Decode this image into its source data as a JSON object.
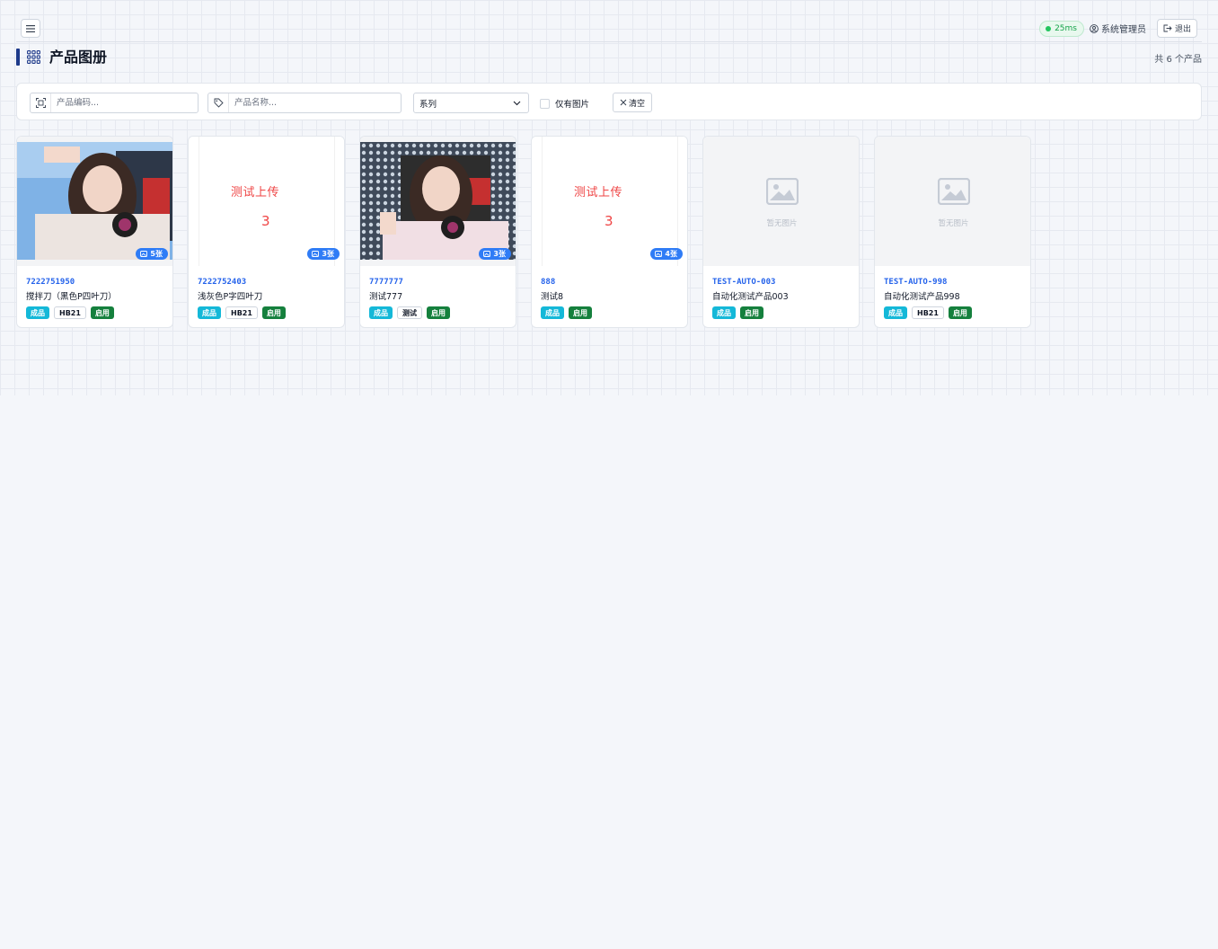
{
  "header": {
    "latency": "25ms",
    "user": "系统管理员",
    "logout_label": "退出"
  },
  "page": {
    "title": "产品图册",
    "count_text": "共 6 个产品"
  },
  "filters": {
    "code_placeholder": "产品编码...",
    "name_placeholder": "产品名称...",
    "series_label": "系列",
    "only_images_label": "仅有图片",
    "clear_label": "清空"
  },
  "colors": {
    "accent": "#2563eb",
    "badge": "#2f7cf6",
    "tag_type": "#14b8d8",
    "tag_status": "#15803d"
  },
  "products": [
    {
      "code": "7222751950",
      "name": "搅拌刀（黑色P四叶刀）",
      "image": "photo",
      "image_count": "5张",
      "type": "成品",
      "series": "HB21",
      "status": "启用"
    },
    {
      "code": "7222752403",
      "name": "浅灰色P字四叶刀",
      "image": "upload",
      "image_count": "3张",
      "upload_text": "测试上传",
      "upload_num": "3",
      "type": "成品",
      "series": "HB21",
      "status": "启用"
    },
    {
      "code": "7777777",
      "name": "测试777",
      "image": "photo",
      "image_count": "3张",
      "type": "成品",
      "series": "测试",
      "status": "启用"
    },
    {
      "code": "888",
      "name": "测试8",
      "image": "upload",
      "image_count": "4张",
      "upload_text": "测试上传",
      "upload_num": "3",
      "type": "成品",
      "series": "",
      "status": "启用"
    },
    {
      "code": "TEST-AUTO-003",
      "name": "自动化测试产品003",
      "image": "none",
      "no_image_text": "暂无图片",
      "type": "成品",
      "series": "",
      "status": "启用"
    },
    {
      "code": "TEST-AUTO-998",
      "name": "自动化测试产品998",
      "image": "none",
      "no_image_text": "暂无图片",
      "type": "成品",
      "series": "HB21",
      "status": "启用"
    }
  ]
}
